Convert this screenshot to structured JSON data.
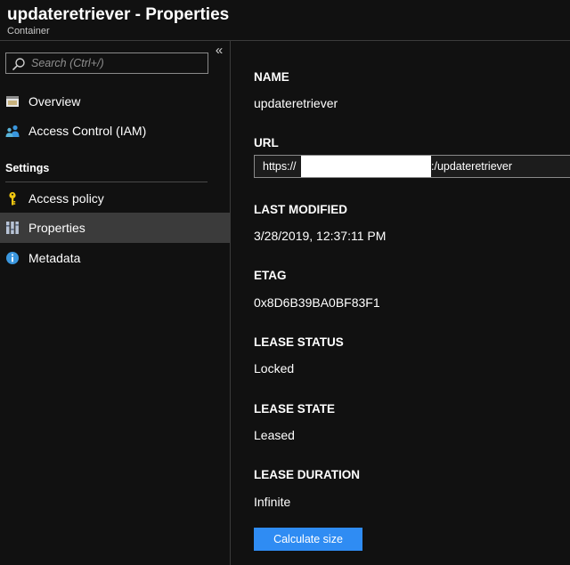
{
  "header": {
    "title": "updateretriever - Properties",
    "subtitle": "Container"
  },
  "sidebar": {
    "collapse_glyph": "«",
    "search": {
      "placeholder": "Search (Ctrl+/)",
      "value": ""
    },
    "items": [
      {
        "label": "Overview",
        "icon": "overview-icon"
      },
      {
        "label": "Access Control (IAM)",
        "icon": "users-icon"
      }
    ],
    "settings_label": "Settings",
    "settings_items": [
      {
        "label": "Access policy",
        "icon": "key-icon"
      },
      {
        "label": "Properties",
        "icon": "properties-icon",
        "active": true
      },
      {
        "label": "Metadata",
        "icon": "info-icon"
      }
    ]
  },
  "properties": {
    "name": {
      "label": "NAME",
      "value": "updateretriever"
    },
    "url": {
      "label": "URL",
      "prefix": "https://",
      "suffix": ":/updateretriever"
    },
    "last_modified": {
      "label": "LAST MODIFIED",
      "value": "3/28/2019, 12:37:11 PM"
    },
    "etag": {
      "label": "ETAG",
      "value": "0x8D6B39BA0BF83F1"
    },
    "lease_status": {
      "label": "LEASE STATUS",
      "value": "Locked"
    },
    "lease_state": {
      "label": "LEASE STATE",
      "value": "Leased"
    },
    "lease_duration": {
      "label": "LEASE DURATION",
      "value": "Infinite"
    }
  },
  "actions": {
    "calculate_size": "Calculate size"
  },
  "colors": {
    "background": "#111111",
    "active_item": "#3b3b3b",
    "accent_button": "#2f8cf3",
    "key_icon": "#f2c811",
    "info_icon": "#3a96dd"
  }
}
